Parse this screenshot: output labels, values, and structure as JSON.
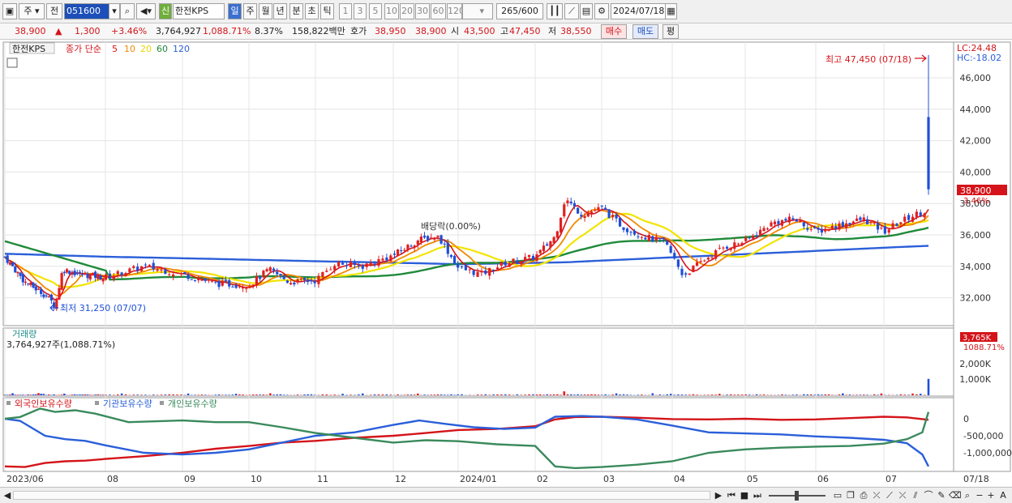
{
  "toolbar": {
    "market": "주",
    "prev": "전",
    "code": "051600",
    "new_badge": "신",
    "stock_name": "한전KPS",
    "periods": [
      "일",
      "주",
      "월",
      "년",
      "분",
      "초",
      "틱"
    ],
    "active_period": "일",
    "intervals": [
      "1",
      "3",
      "5",
      "10",
      "20",
      "30",
      "60",
      "120"
    ],
    "count": "265",
    "count_total": "/600",
    "date": "2024/07/18"
  },
  "info": {
    "price": "38,900",
    "change": "1,300",
    "change_pct": "+3.46%",
    "volume": "3,764,927",
    "volume_pct": "1,088.71%",
    "turnover": "8.37%",
    "amount": "158,822백만",
    "quote_label": "호가",
    "ask": "38,950",
    "bid": "38,900",
    "open_label": "시",
    "open": "43,500",
    "high_label": "고",
    "high": "47,450",
    "low_label": "저",
    "low": "38,550",
    "buy_label": "매수",
    "sell_label": "매도",
    "eval_label": "평"
  },
  "legend": {
    "name": "한전KPS",
    "prefix": "종가 단순",
    "ma": [
      {
        "label": "5",
        "color": "#d4141a"
      },
      {
        "label": "10",
        "color": "#f08a00"
      },
      {
        "label": "20",
        "color": "#e8d800"
      },
      {
        "label": "60",
        "color": "#1f8a3a"
      },
      {
        "label": "120",
        "color": "#2b5fd9"
      }
    ]
  },
  "labels": {
    "lc": "LC:24.48",
    "hc": "HC:-18.02",
    "high_note": "최고 47,450 (07/18)",
    "low_note": "최저 31,250 (07/07)",
    "dividend": "배당락(0.00%)",
    "price_tag": "38,900",
    "price_pct": "3.46%",
    "vol_title": "거래량",
    "vol_info": "3,764,927주(1,088.71%)",
    "vol_tag": "3,765K",
    "vol_pct": "1088.71%",
    "holdings": [
      "외국인보유수량",
      "기관보유수량",
      "개인보유수량"
    ]
  },
  "axes": {
    "price_ticks": [
      "46,000",
      "44,000",
      "42,000",
      "40,000",
      "38,000",
      "36,000",
      "34,000",
      "32,000"
    ],
    "vol_ticks": [
      "2,000K",
      "1,000K"
    ],
    "hold_ticks": [
      "0",
      "-500,000",
      "-1,000,000"
    ],
    "x_ticks": [
      "2023/06",
      "08",
      "09",
      "10",
      "11",
      "12",
      "2024/01",
      "02",
      "03",
      "04",
      "05",
      "06",
      "07",
      "07/18"
    ]
  },
  "chart_data": {
    "type": "candlestick",
    "title": "한전KPS",
    "period": "daily",
    "x_range": [
      "2023/06",
      "2024/07/18"
    ],
    "y_range": [
      31000,
      47600
    ],
    "x_labels": [
      "2023/06",
      "08",
      "09",
      "10",
      "11",
      "12",
      "2024/01",
      "02",
      "03",
      "04",
      "05",
      "06",
      "07"
    ],
    "x_label_month_index": [
      0,
      2,
      3,
      4,
      5,
      6,
      7,
      8,
      9,
      10,
      11,
      12,
      13
    ],
    "close_anchors": [
      {
        "m": 0.0,
        "v": 34600
      },
      {
        "m": 0.4,
        "v": 33000
      },
      {
        "m": 0.8,
        "v": 32200
      },
      {
        "m": 1.0,
        "v": 31500
      },
      {
        "m": 1.15,
        "v": 33800
      },
      {
        "m": 1.5,
        "v": 33500
      },
      {
        "m": 2.0,
        "v": 33300
      },
      {
        "m": 2.5,
        "v": 34000
      },
      {
        "m": 3.0,
        "v": 33500
      },
      {
        "m": 3.5,
        "v": 32900
      },
      {
        "m": 4.0,
        "v": 32800
      },
      {
        "m": 4.3,
        "v": 33800
      },
      {
        "m": 4.6,
        "v": 33000
      },
      {
        "m": 5.0,
        "v": 33100
      },
      {
        "m": 5.25,
        "v": 34200
      },
      {
        "m": 5.6,
        "v": 34000
      },
      {
        "m": 6.0,
        "v": 34700
      },
      {
        "m": 6.4,
        "v": 35700
      },
      {
        "m": 6.7,
        "v": 35900
      },
      {
        "m": 7.0,
        "v": 33900
      },
      {
        "m": 7.3,
        "v": 33500
      },
      {
        "m": 7.6,
        "v": 34200
      },
      {
        "m": 8.0,
        "v": 34600
      },
      {
        "m": 8.3,
        "v": 35900
      },
      {
        "m": 8.45,
        "v": 38300
      },
      {
        "m": 8.7,
        "v": 37300
      },
      {
        "m": 9.0,
        "v": 37700
      },
      {
        "m": 9.3,
        "v": 36500
      },
      {
        "m": 9.6,
        "v": 35900
      },
      {
        "m": 9.9,
        "v": 35500
      },
      {
        "m": 10.15,
        "v": 33400
      },
      {
        "m": 10.4,
        "v": 34300
      },
      {
        "m": 10.7,
        "v": 35200
      },
      {
        "m": 11.0,
        "v": 35600
      },
      {
        "m": 11.4,
        "v": 36800
      },
      {
        "m": 11.7,
        "v": 37000
      },
      {
        "m": 12.0,
        "v": 36200
      },
      {
        "m": 12.4,
        "v": 36700
      },
      {
        "m": 12.7,
        "v": 37000
      },
      {
        "m": 13.0,
        "v": 36200
      },
      {
        "m": 13.2,
        "v": 36800
      },
      {
        "m": 13.4,
        "v": 37300
      },
      {
        "m": 13.58,
        "v": 37600
      }
    ],
    "last_candle": {
      "date": "07/18",
      "open": 43500,
      "high": 47450,
      "low": 38550,
      "close": 38900
    },
    "highest": {
      "value": 47450,
      "date": "07/18"
    },
    "lowest": {
      "value": 31250,
      "date": "07/07"
    },
    "moving_averages": [
      5,
      10,
      20,
      60,
      120
    ],
    "volume_last": 3764927,
    "holdings_series": [
      "외국인보유수량",
      "기관보유수량",
      "개인보유수량"
    ],
    "holdings_range": [
      -1300000,
      300000
    ]
  }
}
